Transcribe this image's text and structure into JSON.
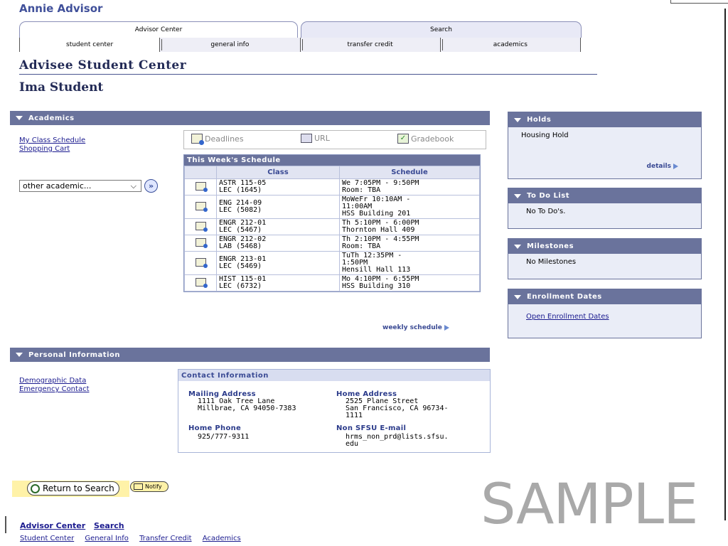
{
  "user_name": "Annie Advisor",
  "tabs": {
    "main": [
      {
        "label": "Advisor Center"
      },
      {
        "label": "Search"
      }
    ],
    "sub": [
      {
        "label": "student center"
      },
      {
        "label": "general info"
      },
      {
        "label": "transfer credit"
      },
      {
        "label": "academics"
      }
    ]
  },
  "page_title": "Advisee Student Center",
  "student_name": "Ima Student",
  "academics": {
    "header": "Academics",
    "links": [
      "My Class Schedule",
      "Shopping Cart"
    ],
    "dropdown_value": "other academic...",
    "toolbar": {
      "deadlines": "Deadlines",
      "url": "URL",
      "gradebook": "Gradebook"
    },
    "schedule": {
      "title": "This Week's Schedule",
      "columns": [
        "Class",
        "Schedule"
      ],
      "rows": [
        {
          "class_line1": "ASTR 115-05",
          "class_line2": "LEC (1645)",
          "sched": [
            "We 7:05PM - 9:50PM",
            "Room:  TBA"
          ]
        },
        {
          "class_line1": "ENG 214-09",
          "class_line2": "LEC (5082)",
          "sched": [
            "MoWeFr 10:10AM -",
            "11:00AM",
            "HSS Building 201"
          ]
        },
        {
          "class_line1": "ENGR 212-01",
          "class_line2": "LEC (5467)",
          "sched": [
            "Th 5:10PM - 6:00PM",
            "Thornton Hall 409"
          ]
        },
        {
          "class_line1": "ENGR 212-02",
          "class_line2": "LAB (5468)",
          "sched": [
            "Th 2:10PM - 4:55PM",
            "Room:  TBA"
          ]
        },
        {
          "class_line1": "ENGR 213-01",
          "class_line2": "LEC (5469)",
          "sched": [
            "TuTh 12:35PM -",
            "1:50PM",
            "Hensill Hall 113"
          ]
        },
        {
          "class_line1": "HIST 115-01",
          "class_line2": "LEC (6732)",
          "sched": [
            "Mo 4:10PM - 6:55PM",
            "HSS Building 310"
          ]
        }
      ],
      "weekly_link": "weekly schedule"
    }
  },
  "personal": {
    "header": "Personal Information",
    "links": [
      "Demographic Data",
      "Emergency Contact"
    ],
    "contact": {
      "title": "Contact Information",
      "mailing_label": "Mailing Address",
      "mailing": [
        "1111 Oak Tree Lane",
        "Millbrae, CA 94050-7383"
      ],
      "home_label": "Home Address",
      "home": [
        "2525 Plane Street",
        "San Francisco, CA 96734-",
        "1111"
      ],
      "phone_label": "Home Phone",
      "phone": "925/777-9311",
      "email_label": "Non SFSU E-mail",
      "email": [
        "hrms_non_prd@lists.sfsu.",
        "edu"
      ]
    }
  },
  "holds": {
    "header": "Holds",
    "item": "Housing Hold",
    "details": "details"
  },
  "todo": {
    "header": "To Do List",
    "item": "No To Do's."
  },
  "milestones": {
    "header": "Milestones",
    "item": "No Milestones"
  },
  "enrollment": {
    "header": "Enrollment Dates",
    "link": "Open Enrollment Dates"
  },
  "buttons": {
    "return": "Return to Search",
    "notify": "Notify"
  },
  "watermark": "SAMPLE",
  "footer": {
    "row1": [
      "Advisor Center",
      "Search"
    ],
    "row2": [
      "Student Center",
      "General Info",
      "Transfer Credit",
      "Academics"
    ]
  }
}
